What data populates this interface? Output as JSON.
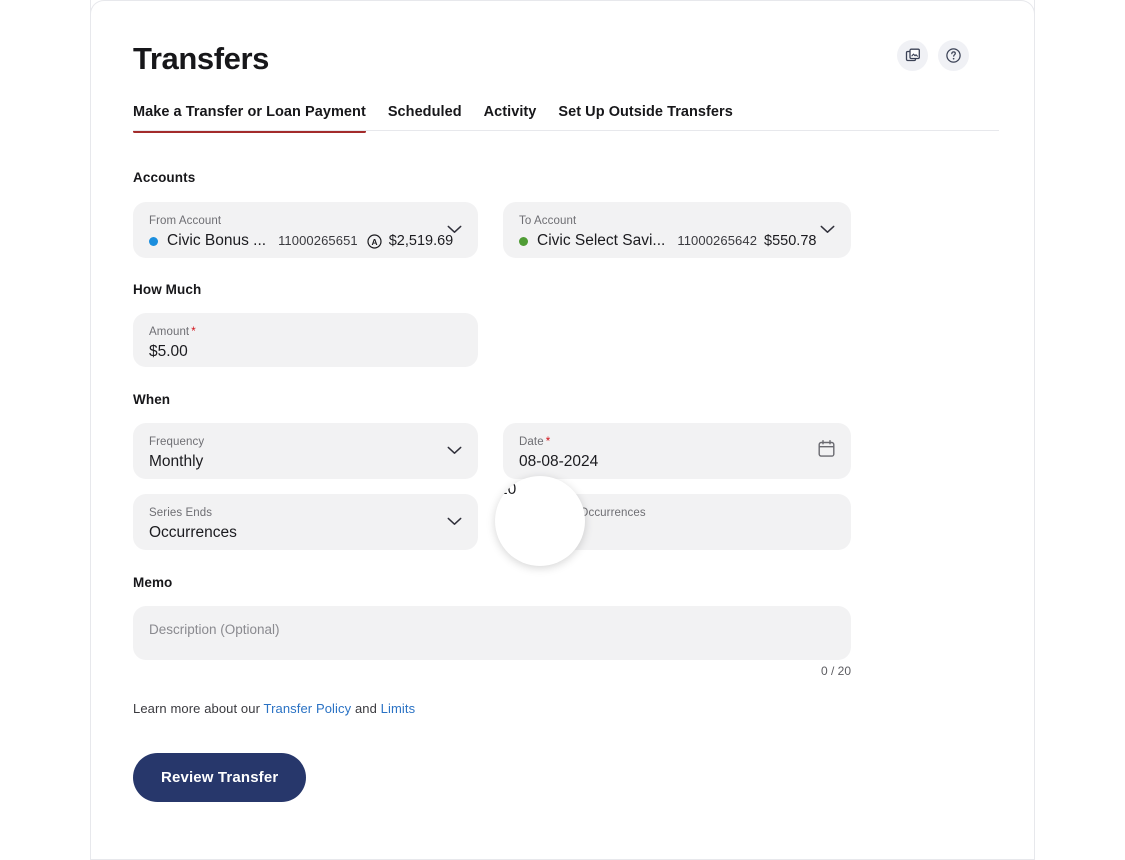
{
  "header": {
    "title": "Transfers",
    "actions": [
      {
        "name": "duplicate-icon",
        "label": "Duplicate"
      },
      {
        "name": "help-icon",
        "label": "Help"
      }
    ]
  },
  "tabs": [
    {
      "label": "Make a Transfer or Loan Payment",
      "active": true
    },
    {
      "label": "Scheduled",
      "active": false
    },
    {
      "label": "Activity",
      "active": false
    },
    {
      "label": "Set Up Outside Transfers",
      "active": false
    }
  ],
  "sections": {
    "accounts": {
      "label": "Accounts",
      "from": {
        "label": "From Account",
        "dot_color": "#1b8ede",
        "name": "Civic Bonus ...",
        "number": "11000265651",
        "badge": "A",
        "balance": "$2,519.69"
      },
      "to": {
        "label": "To Account",
        "dot_color": "#4f9c35",
        "name": "Civic Select Savi...",
        "number": "11000265642",
        "badge": "",
        "balance": "$550.78"
      }
    },
    "how_much": {
      "label": "How Much",
      "amount": {
        "label": "Amount",
        "required": "*",
        "value": "$5.00"
      }
    },
    "when": {
      "label": "When",
      "frequency": {
        "label": "Frequency",
        "value": "Monthly"
      },
      "date": {
        "label": "Date",
        "required": "*",
        "value": "08-08-2024"
      },
      "series_ends": {
        "label": "Series Ends",
        "value": "Occurrences"
      },
      "occurrences": {
        "label": "Number Of Occurrences",
        "value": "10"
      }
    },
    "memo": {
      "label": "Memo",
      "placeholder": "Description (Optional)",
      "counter": "0 / 20"
    }
  },
  "footer": {
    "learn_prefix": "Learn more about our ",
    "policy_link": "Transfer Policy",
    "learn_mid": " and ",
    "limits_link": "Limits",
    "submit_label": "Review Transfer"
  },
  "colors": {
    "accent_red": "#a32b2b",
    "primary_navy": "#27376b",
    "link_blue": "#2a72c4",
    "field_bg": "#f2f2f3"
  }
}
